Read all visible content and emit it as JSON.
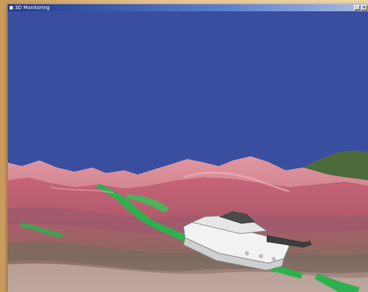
{
  "window": {
    "title": "3D Monitoring",
    "min_glyph": "_",
    "close_glyph": "×"
  },
  "scene": {
    "sky_color": "#3a4ea0",
    "terrain_colors": [
      "#b9506a",
      "#d77a86",
      "#7b8a4a",
      "#29a84c",
      "#6e5a60",
      "#e7a0a6"
    ],
    "vehicle_color": "#f2f2f2"
  }
}
